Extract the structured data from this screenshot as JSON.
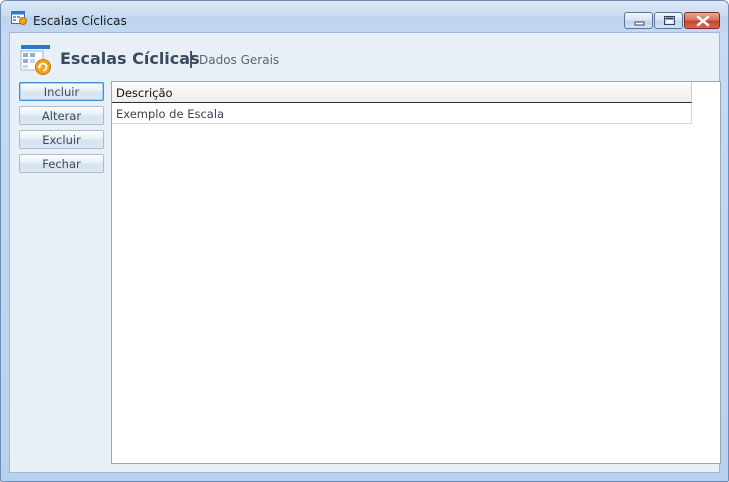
{
  "window": {
    "title": "Escalas Cíclicas",
    "controls": {
      "minimize_icon": "minimize-icon",
      "maximize_icon": "maximize-icon",
      "close_icon": "close-icon"
    }
  },
  "header": {
    "icon": "calendar-refresh-icon",
    "title": "Escalas Cíclicas",
    "separator": "|",
    "subtitle": "Dados Gerais"
  },
  "actions": {
    "include": "Incluir",
    "edit": "Alterar",
    "delete": "Excluir",
    "close": "Fechar"
  },
  "grid": {
    "columns": [
      "Descrição"
    ],
    "rows": [
      [
        "Exemplo de Escala"
      ]
    ]
  },
  "colors": {
    "accent": "#3d8fd6",
    "close_button": "#c6452c",
    "header_text": "#3a4a5e"
  }
}
